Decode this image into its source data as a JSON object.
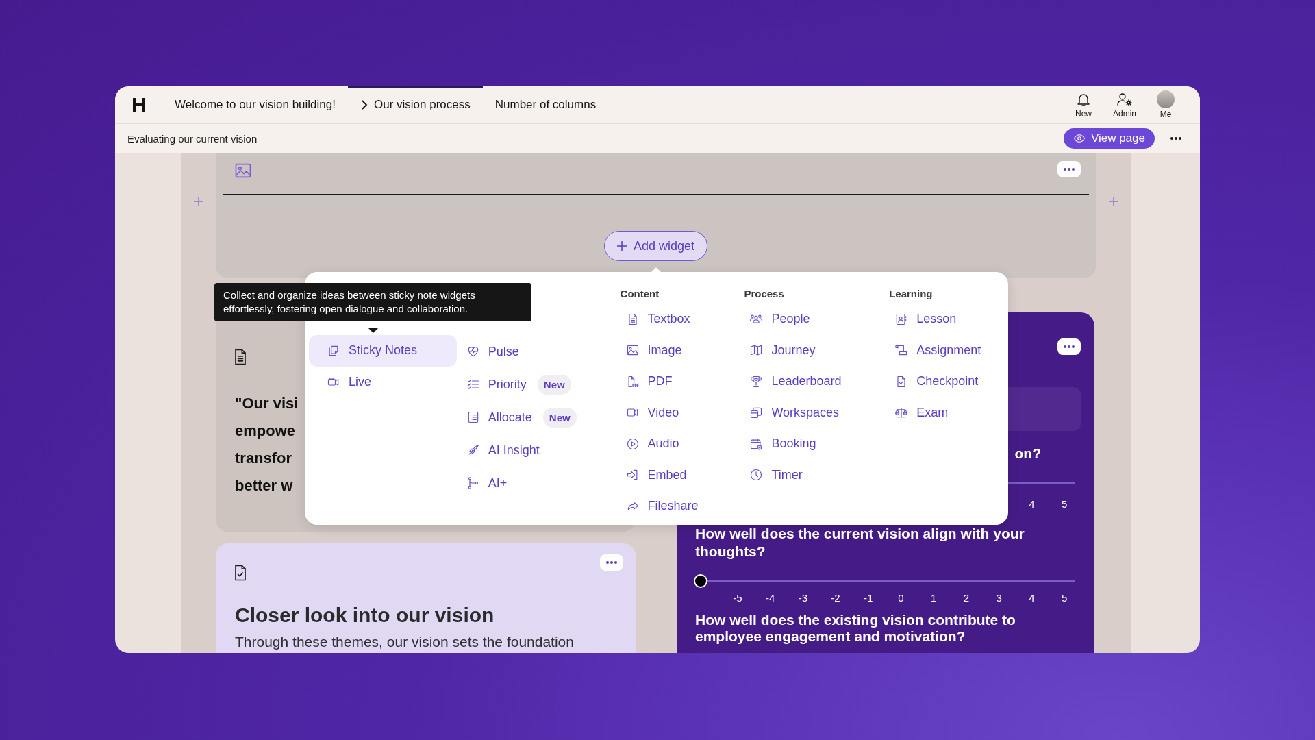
{
  "header": {
    "logo": "H",
    "tabs": [
      {
        "label": "Welcome to our vision building!",
        "kind": "page",
        "selected": false
      },
      {
        "label": "Our vision process",
        "kind": "subpage",
        "selected": true
      },
      {
        "label": "Number of columns",
        "kind": "page",
        "selected": false
      }
    ],
    "actions": [
      {
        "label": "New",
        "kind": "bell"
      },
      {
        "label": "Admin",
        "kind": "admin"
      },
      {
        "label": "Me",
        "kind": "avatar"
      }
    ]
  },
  "subheader": {
    "title": "Evaluating our current vision",
    "view_button": "View page"
  },
  "canvas": {
    "add_widget": "Add widget",
    "quote_lines": [
      "\"Our visi",
      "empowe",
      "transfor",
      "better w"
    ],
    "closer_card": {
      "title": "Closer look into our vision",
      "body": "Through these themes, our vision sets the foundation"
    },
    "survey": {
      "partial_question": "on?",
      "partial_scale": [
        "4",
        "5"
      ],
      "questions": [
        {
          "text": "How well does the current vision align with your thoughts?",
          "level": 0,
          "scale": [
            "-5",
            "-4",
            "-3",
            "-2",
            "-1",
            "0",
            "1",
            "2",
            "3",
            "4",
            "5"
          ]
        },
        {
          "text": "How well does the existing vision contribute to employee engagement and motivation?"
        }
      ]
    }
  },
  "tooltip": {
    "text": "Collect and organize ideas between sticky note widgets effortlessly, fostering open dialogue and collaboration."
  },
  "widget_menu": {
    "columns": [
      {
        "items": [
          {
            "label": "Sticky Notes",
            "selected": true
          },
          {
            "label": "Live",
            "selected": false
          }
        ]
      },
      {
        "items": [
          {
            "label": "Pulse",
            "selected": false
          },
          {
            "label": "Priority",
            "badge": "New",
            "selected": false
          },
          {
            "label": "Allocate",
            "badge": "New",
            "selected": false
          },
          {
            "label": "AI Insight",
            "selected": false
          },
          {
            "label": "AI+",
            "selected": false
          }
        ]
      },
      {
        "heading": "Content",
        "items": [
          {
            "label": "Textbox",
            "selected": false
          },
          {
            "label": "Image",
            "selected": false
          },
          {
            "label": "PDF",
            "selected": false
          },
          {
            "label": "Video",
            "selected": false
          },
          {
            "label": "Audio",
            "selected": false
          },
          {
            "label": "Embed",
            "selected": false
          },
          {
            "label": "Fileshare",
            "selected": false
          }
        ]
      },
      {
        "heading": "Process",
        "items": [
          {
            "label": "People",
            "selected": false
          },
          {
            "label": "Journey",
            "selected": false
          },
          {
            "label": "Leaderboard",
            "selected": false
          },
          {
            "label": "Workspaces",
            "selected": false
          },
          {
            "label": "Booking",
            "selected": false
          },
          {
            "label": "Timer",
            "selected": false
          }
        ]
      },
      {
        "heading": "Learning",
        "items": [
          {
            "label": "Lesson",
            "selected": false
          },
          {
            "label": "Assignment",
            "selected": false
          },
          {
            "label": "Checkpoint",
            "selected": false
          },
          {
            "label": "Exam",
            "selected": false
          }
        ]
      }
    ]
  }
}
